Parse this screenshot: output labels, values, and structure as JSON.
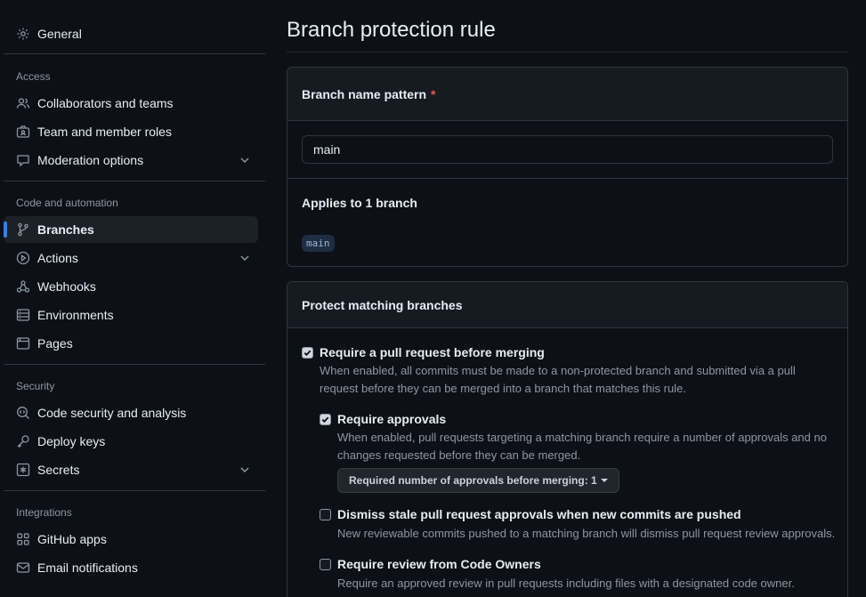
{
  "sidebar": {
    "general": "General",
    "sections": {
      "access": "Access",
      "code_automation": "Code and automation",
      "security": "Security",
      "integrations": "Integrations"
    },
    "items": {
      "collaborators": "Collaborators and teams",
      "team_roles": "Team and member roles",
      "moderation": "Moderation options",
      "branches": "Branches",
      "actions": "Actions",
      "webhooks": "Webhooks",
      "environments": "Environments",
      "pages": "Pages",
      "code_security": "Code security and analysis",
      "deploy_keys": "Deploy keys",
      "secrets": "Secrets",
      "github_apps": "GitHub apps",
      "email_notifications": "Email notifications"
    }
  },
  "main": {
    "title": "Branch protection rule",
    "pattern_box": {
      "header": "Branch name pattern",
      "required_mark": "*",
      "input_value": "main",
      "applies_text": "Applies to 1 branch",
      "branch_chip": "main"
    },
    "protect_box": {
      "header": "Protect matching branches",
      "options": {
        "require_pr": {
          "title": "Require a pull request before merging",
          "checked": true,
          "desc": "When enabled, all commits must be made to a non-protected branch and submitted via a pull request before they can be merged into a branch that matches this rule."
        },
        "require_approvals": {
          "title": "Require approvals",
          "checked": true,
          "desc": "When enabled, pull requests targeting a matching branch require a number of approvals and no changes requested before they can be merged.",
          "select_label": "Required number of approvals before merging: 1"
        },
        "dismiss_stale": {
          "title": "Dismiss stale pull request approvals when new commits are pushed",
          "checked": false,
          "desc": "New reviewable commits pushed to a matching branch will dismiss pull request review approvals."
        },
        "code_owners": {
          "title": "Require review from Code Owners",
          "checked": false,
          "desc": "Require an approved review in pull requests including files with a designated code owner."
        }
      }
    }
  },
  "colors": {
    "background": "#0d1117",
    "border": "#30363d",
    "accent": "#2f81f7",
    "muted_text": "#8d96a0",
    "required": "#f85149"
  },
  "icons": {
    "general": "gear-icon",
    "collaborators": "people-icon",
    "team_roles": "id-badge-icon",
    "moderation": "comment-icon",
    "branches": "git-branch-icon",
    "actions": "play-icon",
    "webhooks": "webhook-icon",
    "environments": "server-icon",
    "pages": "browser-icon",
    "code_security": "codescan-icon",
    "deploy_keys": "key-icon",
    "secrets": "asterisk-icon",
    "github_apps": "apps-icon",
    "email_notifications": "mail-icon"
  }
}
